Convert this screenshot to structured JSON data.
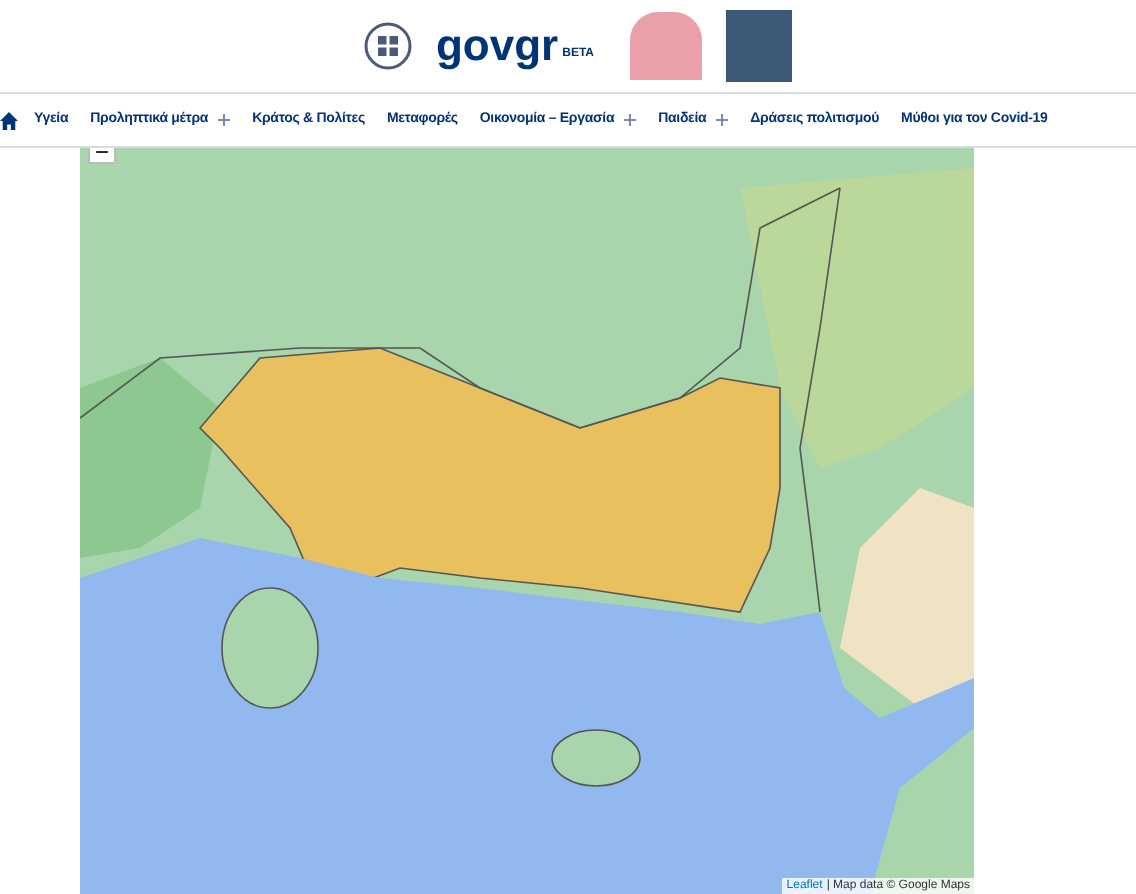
{
  "header": {
    "logo_text": "govgr",
    "logo_badge": "BETA"
  },
  "nav": {
    "items": [
      {
        "label": "Υγεία",
        "submenu": false
      },
      {
        "label": "Προληπτικά μέτρα",
        "submenu": true
      },
      {
        "label": "Κράτος & Πολίτες",
        "submenu": false
      },
      {
        "label": "Μεταφορές",
        "submenu": false
      },
      {
        "label": "Οικονομία – Εργασία",
        "submenu": true
      },
      {
        "label": "Παιδεία",
        "submenu": true
      },
      {
        "label": "Δράσεις πολιτισμού",
        "submenu": false
      },
      {
        "label": "Μύθοι για τον Covid-19",
        "submenu": false
      }
    ]
  },
  "map": {
    "zoom_out": "−",
    "attribution": {
      "link": "Leaflet",
      "text": "| Map data © Google Maps"
    }
  }
}
